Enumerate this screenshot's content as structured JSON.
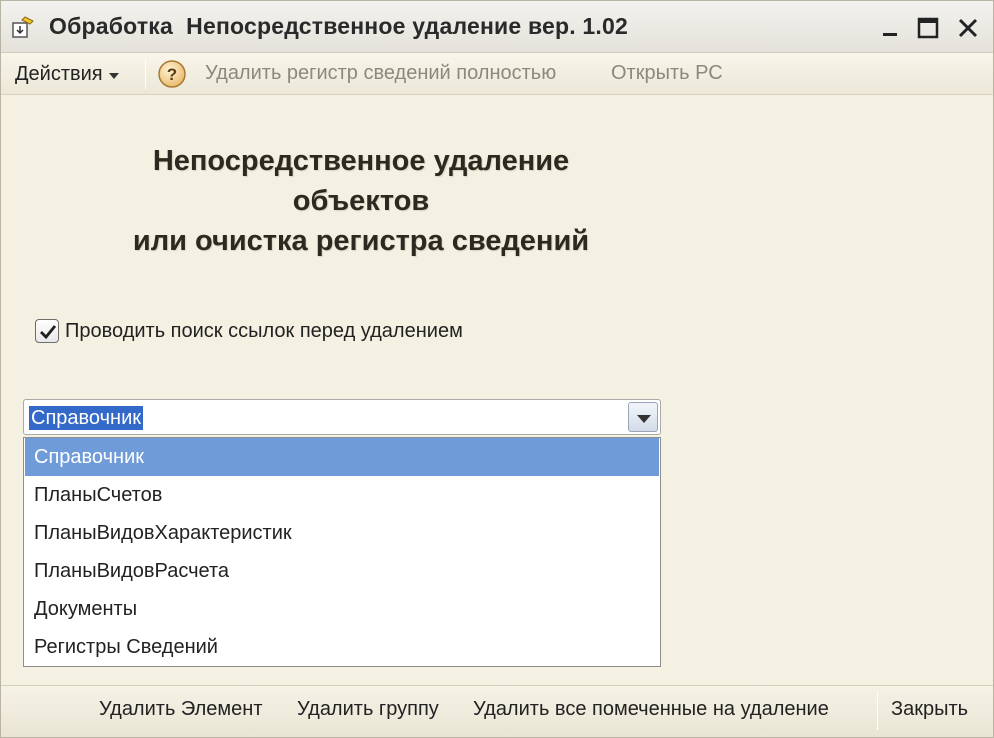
{
  "window": {
    "title": "Обработка  Непосредственное удаление вер. 1.02"
  },
  "toolbar": {
    "actions_label": "Действия",
    "delete_register_label": "Удалить регистр сведений полностью",
    "open_register_label": "Открыть РС"
  },
  "content": {
    "heading_line1": "Непосредственное удаление",
    "heading_line2": "объектов",
    "heading_line3": "или очистка регистра сведений",
    "checkbox_label": "Проводить поиск ссылок перед удалением",
    "checkbox_checked": true
  },
  "combo": {
    "value": "Справочник",
    "options": [
      "Справочник",
      "ПланыСчетов",
      "ПланыВидовХарактеристик",
      "ПланыВидовРасчета",
      "Документы",
      "Регистры Сведений"
    ],
    "selected_index": 0
  },
  "bottombar": {
    "delete_element_label": "Удалить Элемент",
    "delete_group_label": "Удалить группу",
    "delete_marked_label": "Удалить все помеченные на удаление",
    "close_label": "Закрыть"
  },
  "colors": {
    "window_bg": "#f4f0e2",
    "selection": "#6f9bd8",
    "selection_text_bg": "#3369c9",
    "link_disabled": "#8b8a7a"
  }
}
